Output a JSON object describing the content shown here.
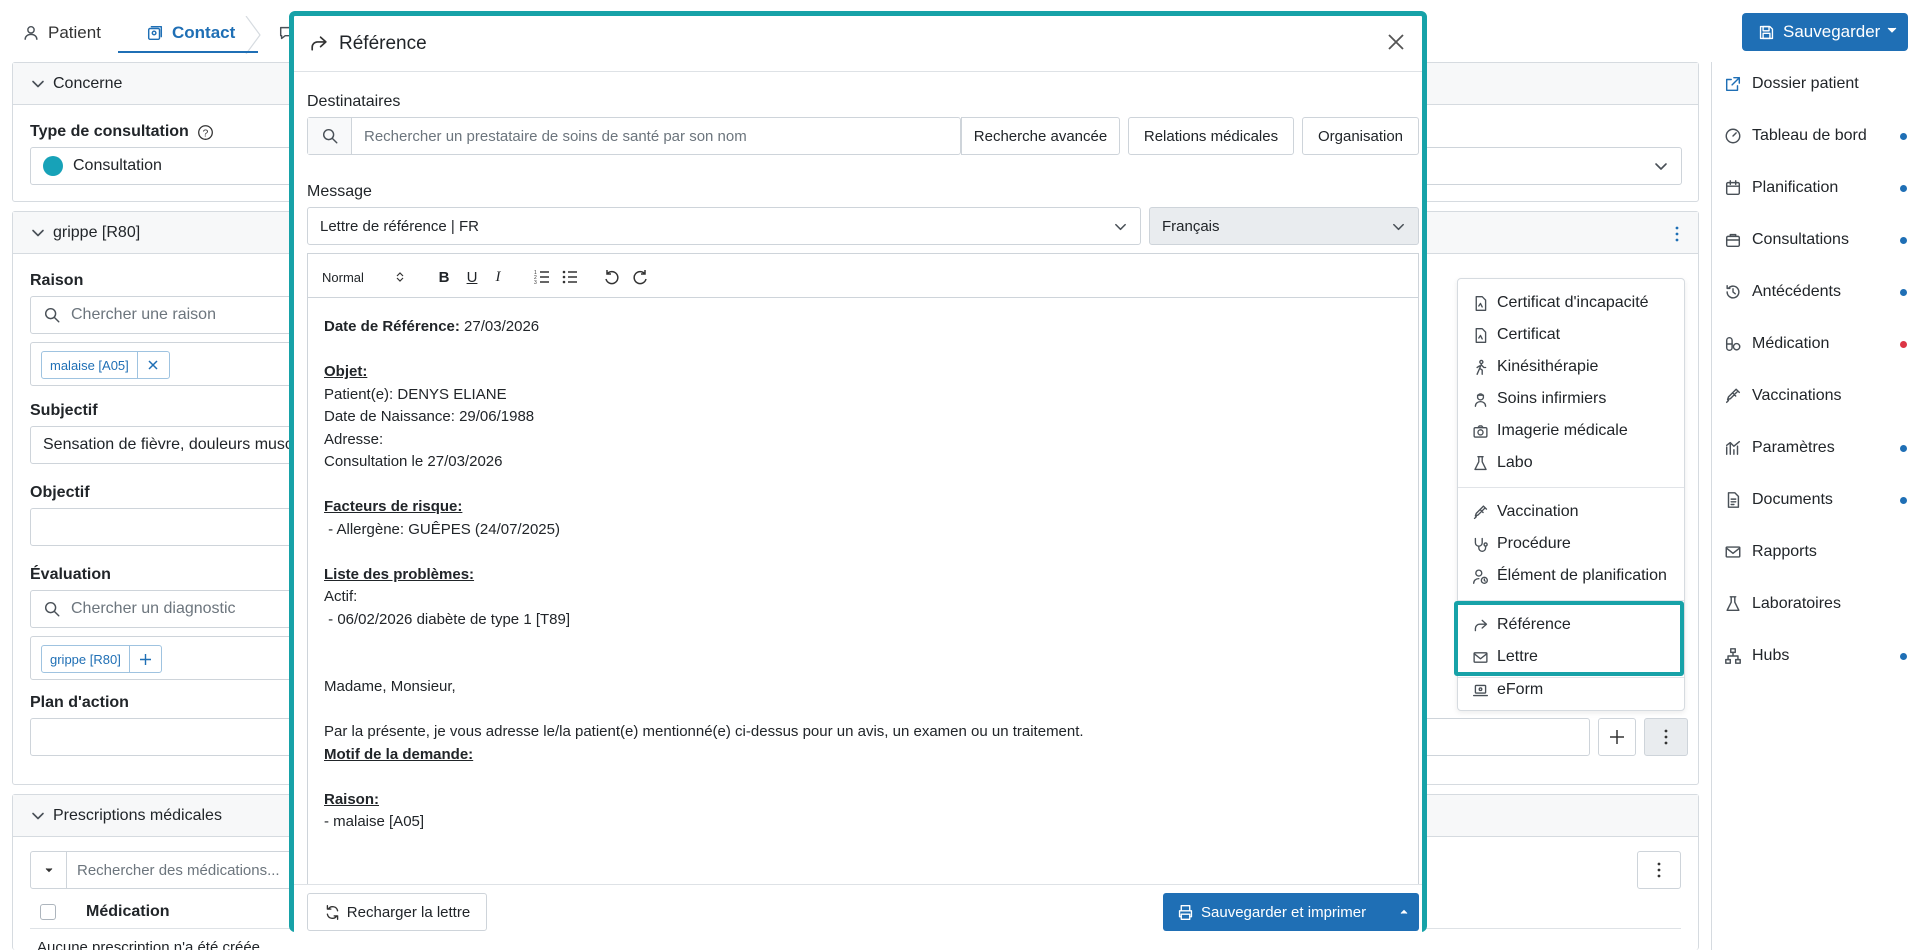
{
  "top_tabs": [
    {
      "label": "Patient"
    },
    {
      "label": "Contact"
    }
  ],
  "toolbar": {
    "save_label": "Sauvegarder"
  },
  "concerne": {
    "title": "Concerne",
    "type_label": "Type de consultation",
    "type_value": "Consultation"
  },
  "problem": {
    "title": "grippe [R80]",
    "raison_label": "Raison",
    "raison_placeholder": "Chercher une raison",
    "raison_chip": "malaise [A05]",
    "subjectif_label": "Subjectif",
    "subjectif_value": "Sensation de fièvre, douleurs musc",
    "objectif_label": "Objectif",
    "evaluation_label": "Évaluation",
    "evaluation_placeholder": "Chercher un diagnostic",
    "evaluation_chip": "grippe [R80]",
    "plan_label": "Plan d'action"
  },
  "prescriptions": {
    "title": "Prescriptions médicales",
    "search_placeholder": "Rechercher des médications...",
    "column_medication": "Médication",
    "empty_text": "Aucune prescription n'a été créée"
  },
  "sidebar": {
    "items": [
      {
        "label": "Dossier patient",
        "icon": "external-link-icon",
        "dot": ""
      },
      {
        "label": "Tableau de bord",
        "icon": "dashboard-icon",
        "dot": "#1f6fb5"
      },
      {
        "label": "Planification",
        "icon": "calendar-icon",
        "dot": "#1f6fb5"
      },
      {
        "label": "Consultations",
        "icon": "briefcase-icon",
        "dot": "#1f6fb5"
      },
      {
        "label": "Antécédents",
        "icon": "history-icon",
        "dot": "#1f6fb5"
      },
      {
        "label": "Médication",
        "icon": "pill-icon",
        "dot": "#dc3545"
      },
      {
        "label": "Vaccinations",
        "icon": "syringe-icon",
        "dot": ""
      },
      {
        "label": "Paramètres",
        "icon": "chart-icon",
        "dot": "#1f6fb5"
      },
      {
        "label": "Documents",
        "icon": "document-icon",
        "dot": "#1f6fb5"
      },
      {
        "label": "Rapports",
        "icon": "mail-icon",
        "dot": ""
      },
      {
        "label": "Laboratoires",
        "icon": "flask-icon",
        "dot": ""
      },
      {
        "label": "Hubs",
        "icon": "hub-icon",
        "dot": "#1f6fb5"
      }
    ]
  },
  "menu": {
    "items": [
      {
        "label": "Certificat d'incapacité",
        "icon": "file-icon"
      },
      {
        "label": "Certificat",
        "icon": "file-icon"
      },
      {
        "label": "Kinésithérapie",
        "icon": "walking-icon"
      },
      {
        "label": "Soins infirmiers",
        "icon": "nurse-icon"
      },
      {
        "label": "Imagerie médicale",
        "icon": "camera-icon"
      },
      {
        "label": "Labo",
        "icon": "flask-icon"
      },
      {
        "label": "Vaccination",
        "icon": "syringe-icon"
      },
      {
        "label": "Procédure",
        "icon": "stethoscope-icon"
      },
      {
        "label": "Élément de planification",
        "icon": "person-clock-icon"
      },
      {
        "label": "Référence",
        "icon": "share-icon"
      },
      {
        "label": "Lettre",
        "icon": "mail-icon"
      },
      {
        "label": "eForm",
        "icon": "laptop-icon"
      }
    ]
  },
  "modal": {
    "title": "Référence",
    "recipients_label": "Destinataires",
    "search_placeholder": "Rechercher un prestataire de soins de santé par son nom",
    "btn_advanced": "Recherche avancée",
    "btn_relations": "Relations médicales",
    "btn_organisation": "Organisation",
    "message_label": "Message",
    "template_value": "Lettre de référence | FR",
    "language_value": "Français",
    "format_value": "Normal",
    "reload_label": "Recharger la lettre",
    "save_print_label": "Sauvegarder et imprimer"
  },
  "letter": {
    "date_label": "Date de Référence:",
    "date_value": " 27/03/2026",
    "objet_heading": "Objet:",
    "patient_line": "Patient(e): DENYS ELIANE",
    "birth_line": "Date de Naissance: 29/06/1988",
    "address_line": "Adresse:",
    "consult_line": "Consultation le 27/03/2026",
    "risk_heading": "Facteurs de risque:",
    "risk_line": " - Allergène: GUÊPES (24/07/2025)",
    "problems_heading": "Liste des problèmes:",
    "active_line": "Actif:",
    "problem_line": " - 06/02/2026 diabète de type 1 [T89]",
    "salutation": "Madame, Monsieur,",
    "intro": "Par la présente, je vous adresse le/la patient(e) mentionné(e) ci-dessus pour un avis, un examen ou un traitement.",
    "motif_heading": "Motif de la demande:",
    "reason_heading": "Raison:",
    "reason_line": "- malaise [A05]"
  }
}
